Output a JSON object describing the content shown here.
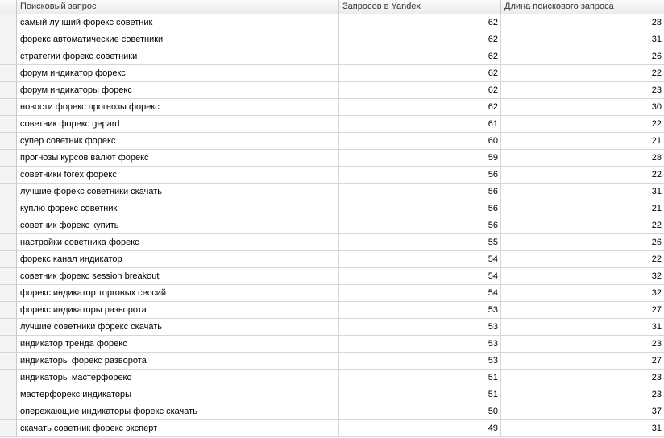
{
  "columns": {
    "query": "Поисковый запрос",
    "yandex": "Запросов в Yandex",
    "length": "Длина поискового запроса"
  },
  "rows": [
    {
      "query": "самый лучший форекс советник",
      "yandex": "62",
      "length": "28"
    },
    {
      "query": "форекс автоматические советники",
      "yandex": "62",
      "length": "31"
    },
    {
      "query": "стратегии форекс советники",
      "yandex": "62",
      "length": "26"
    },
    {
      "query": "форум индикатор форекс",
      "yandex": "62",
      "length": "22"
    },
    {
      "query": "форум индикаторы форекс",
      "yandex": "62",
      "length": "23"
    },
    {
      "query": "новости форекс прогнозы форекс",
      "yandex": "62",
      "length": "30"
    },
    {
      "query": "советник форекс gepard",
      "yandex": "61",
      "length": "22"
    },
    {
      "query": "супер советник форекс",
      "yandex": "60",
      "length": "21"
    },
    {
      "query": "прогнозы курсов валют форекс",
      "yandex": "59",
      "length": "28"
    },
    {
      "query": "советники forex форекс",
      "yandex": "56",
      "length": "22"
    },
    {
      "query": "лучшие форекс советники скачать",
      "yandex": "56",
      "length": "31"
    },
    {
      "query": "куплю форекс советник",
      "yandex": "56",
      "length": "21"
    },
    {
      "query": "советник форекс купить",
      "yandex": "56",
      "length": "22"
    },
    {
      "query": "настройки советника форекс",
      "yandex": "55",
      "length": "26"
    },
    {
      "query": "форекс канал индикатор",
      "yandex": "54",
      "length": "22"
    },
    {
      "query": "советник форекс session breakout",
      "yandex": "54",
      "length": "32"
    },
    {
      "query": "форекс индикатор торговых сессий",
      "yandex": "54",
      "length": "32"
    },
    {
      "query": "форекс индикаторы разворота",
      "yandex": "53",
      "length": "27"
    },
    {
      "query": "лучшие советники форекс скачать",
      "yandex": "53",
      "length": "31"
    },
    {
      "query": "индикатор тренда форекс",
      "yandex": "53",
      "length": "23"
    },
    {
      "query": "индикаторы форекс разворота",
      "yandex": "53",
      "length": "27"
    },
    {
      "query": "индикаторы мастерфорекс",
      "yandex": "51",
      "length": "23"
    },
    {
      "query": "мастерфорекс индикаторы",
      "yandex": "51",
      "length": "23"
    },
    {
      "query": "опережающие индикаторы форекс скачать",
      "yandex": "50",
      "length": "37"
    },
    {
      "query": "скачать советник форекс эксперт",
      "yandex": "49",
      "length": "31"
    }
  ]
}
